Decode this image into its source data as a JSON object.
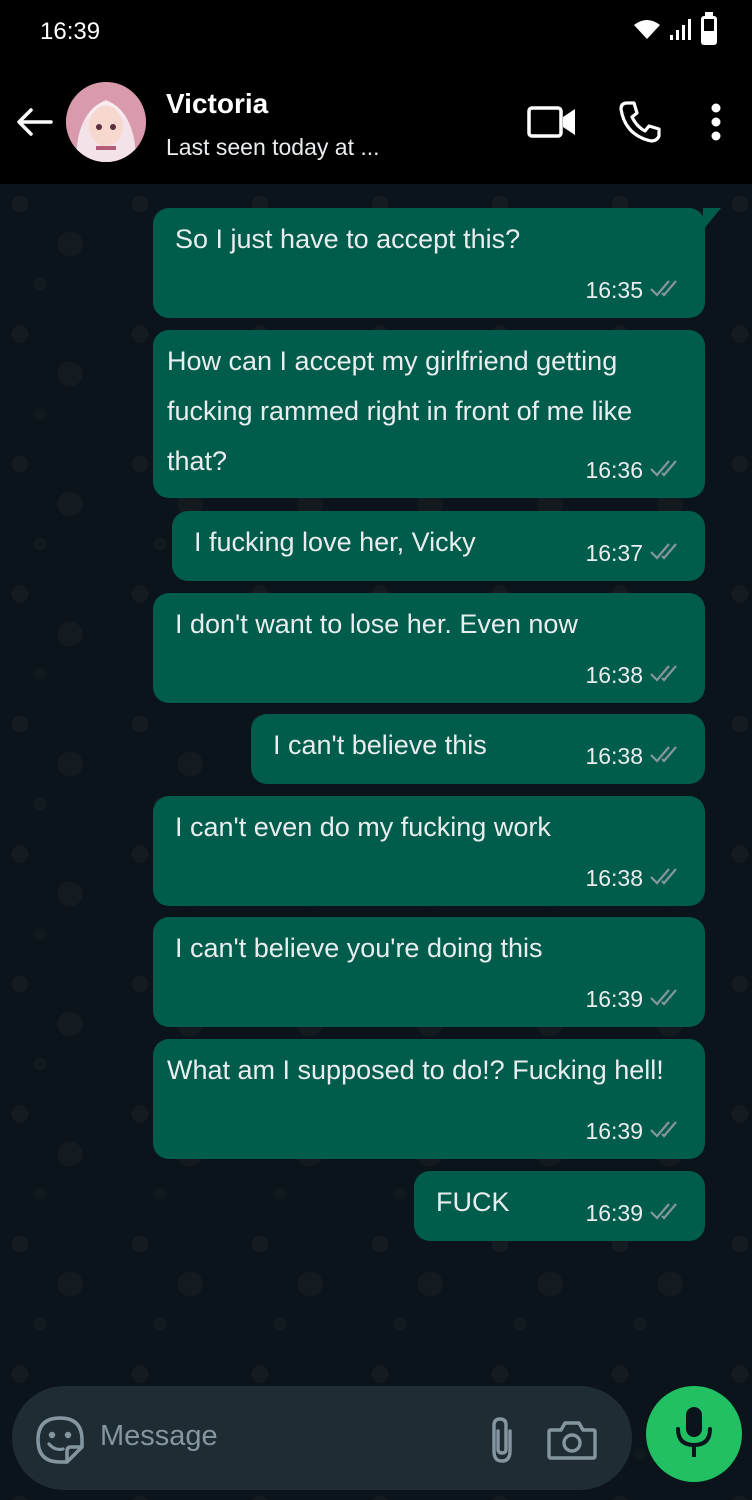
{
  "status_bar": {
    "time": "16:39"
  },
  "header": {
    "contact_name": "Victoria",
    "last_seen": "Last seen today at ...",
    "icons": [
      "back-arrow-icon",
      "avatar",
      "video-call-icon",
      "phone-icon",
      "more-vert-icon"
    ]
  },
  "messages": [
    {
      "text": "So I just have to accept this?",
      "time": "16:35",
      "status": "read"
    },
    {
      "text": " How can I accept my girlfriend getting fucking rammed right in front of me like that?",
      "time": "16:36",
      "status": "read"
    },
    {
      "text": "I fucking love her, Vicky",
      "time": "16:37",
      "status": "read"
    },
    {
      "text": "I don't want to lose her. Even now",
      "time": "16:38",
      "status": "read"
    },
    {
      "text": "I can't believe this",
      "time": "16:38",
      "status": "read"
    },
    {
      "text": "I can't even do my fucking work",
      "time": "16:38",
      "status": "read"
    },
    {
      "text": "I can't believe you're doing this",
      "time": "16:39",
      "status": "read"
    },
    {
      "text": " What am I supposed to do!? Fucking hell!",
      "time": "16:39",
      "status": "read"
    },
    {
      "text": "FUCK",
      "time": "16:39",
      "status": "read"
    }
  ],
  "input_bar": {
    "placeholder": "Message",
    "icons": [
      "sticker-icon",
      "attach-icon",
      "camera-icon",
      "mic-icon"
    ]
  },
  "colors": {
    "bubble_out": "#005c4b",
    "chat_bg": "#0b141a",
    "input_bg": "#1f2c34",
    "mic_green": "#21c063"
  }
}
